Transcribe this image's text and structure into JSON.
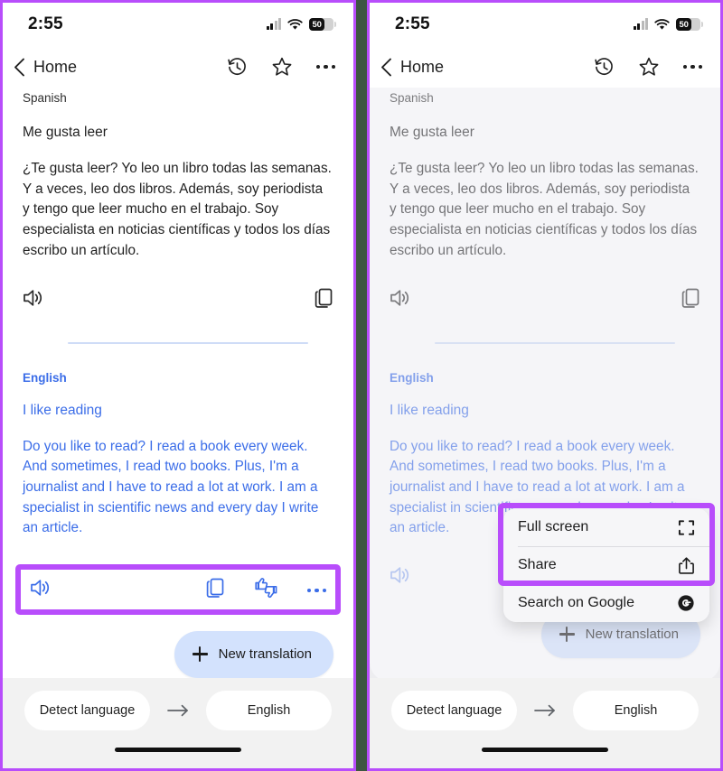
{
  "status_bar": {
    "time": "2:55",
    "battery_level": "50",
    "signal_icon": "cellular-signal-icon",
    "wifi_icon": "wifi-icon",
    "battery_icon": "battery-icon"
  },
  "app_bar": {
    "back_label": "Home",
    "back_icon": "chevron-left-icon",
    "history_icon": "history-clock-icon",
    "star_icon": "star-outline-icon",
    "more_icon": "more-horizontal-icon"
  },
  "source": {
    "language": "Spanish",
    "headline": "Me gusta leer",
    "body": "¿Te gusta leer? Yo leo un libro todas las semanas. Y a veces, leo dos libros. Además, soy periodista y tengo que leer mucho en el trabajo. Soy especialista en noticias científicas y todos los días escribo un artículo.",
    "speaker_icon": "speaker-volume-icon",
    "copy_icon": "copy-icon"
  },
  "target": {
    "language": "English",
    "headline": "I like reading",
    "body": "Do you like to read? I read a book every week. And sometimes, I read two books. Plus, I'm a journalist and I have to read a lot at work. I am a specialist in scientific news and every day I write an article.",
    "speaker_icon": "speaker-volume-icon",
    "copy_icon": "copy-icon",
    "feedback_icon": "thumbs-up-down-icon",
    "more_icon": "more-horizontal-icon"
  },
  "new_translation": {
    "label": "New translation",
    "plus_icon": "plus-icon"
  },
  "language_bar": {
    "source_label": "Detect language",
    "arrow_icon": "arrow-right-icon",
    "target_label": "English"
  },
  "popup_menu": {
    "items": [
      {
        "label": "Full screen",
        "icon": "fullscreen-icon"
      },
      {
        "label": "Share",
        "icon": "share-upload-icon"
      },
      {
        "label": "Search on Google",
        "icon": "google-g-icon"
      }
    ]
  },
  "colors": {
    "highlight_purple": "#b84dfb",
    "translation_blue": "#3b6de8",
    "button_blue": "#d3e2fd",
    "panel_background": "#f2f2f2"
  }
}
